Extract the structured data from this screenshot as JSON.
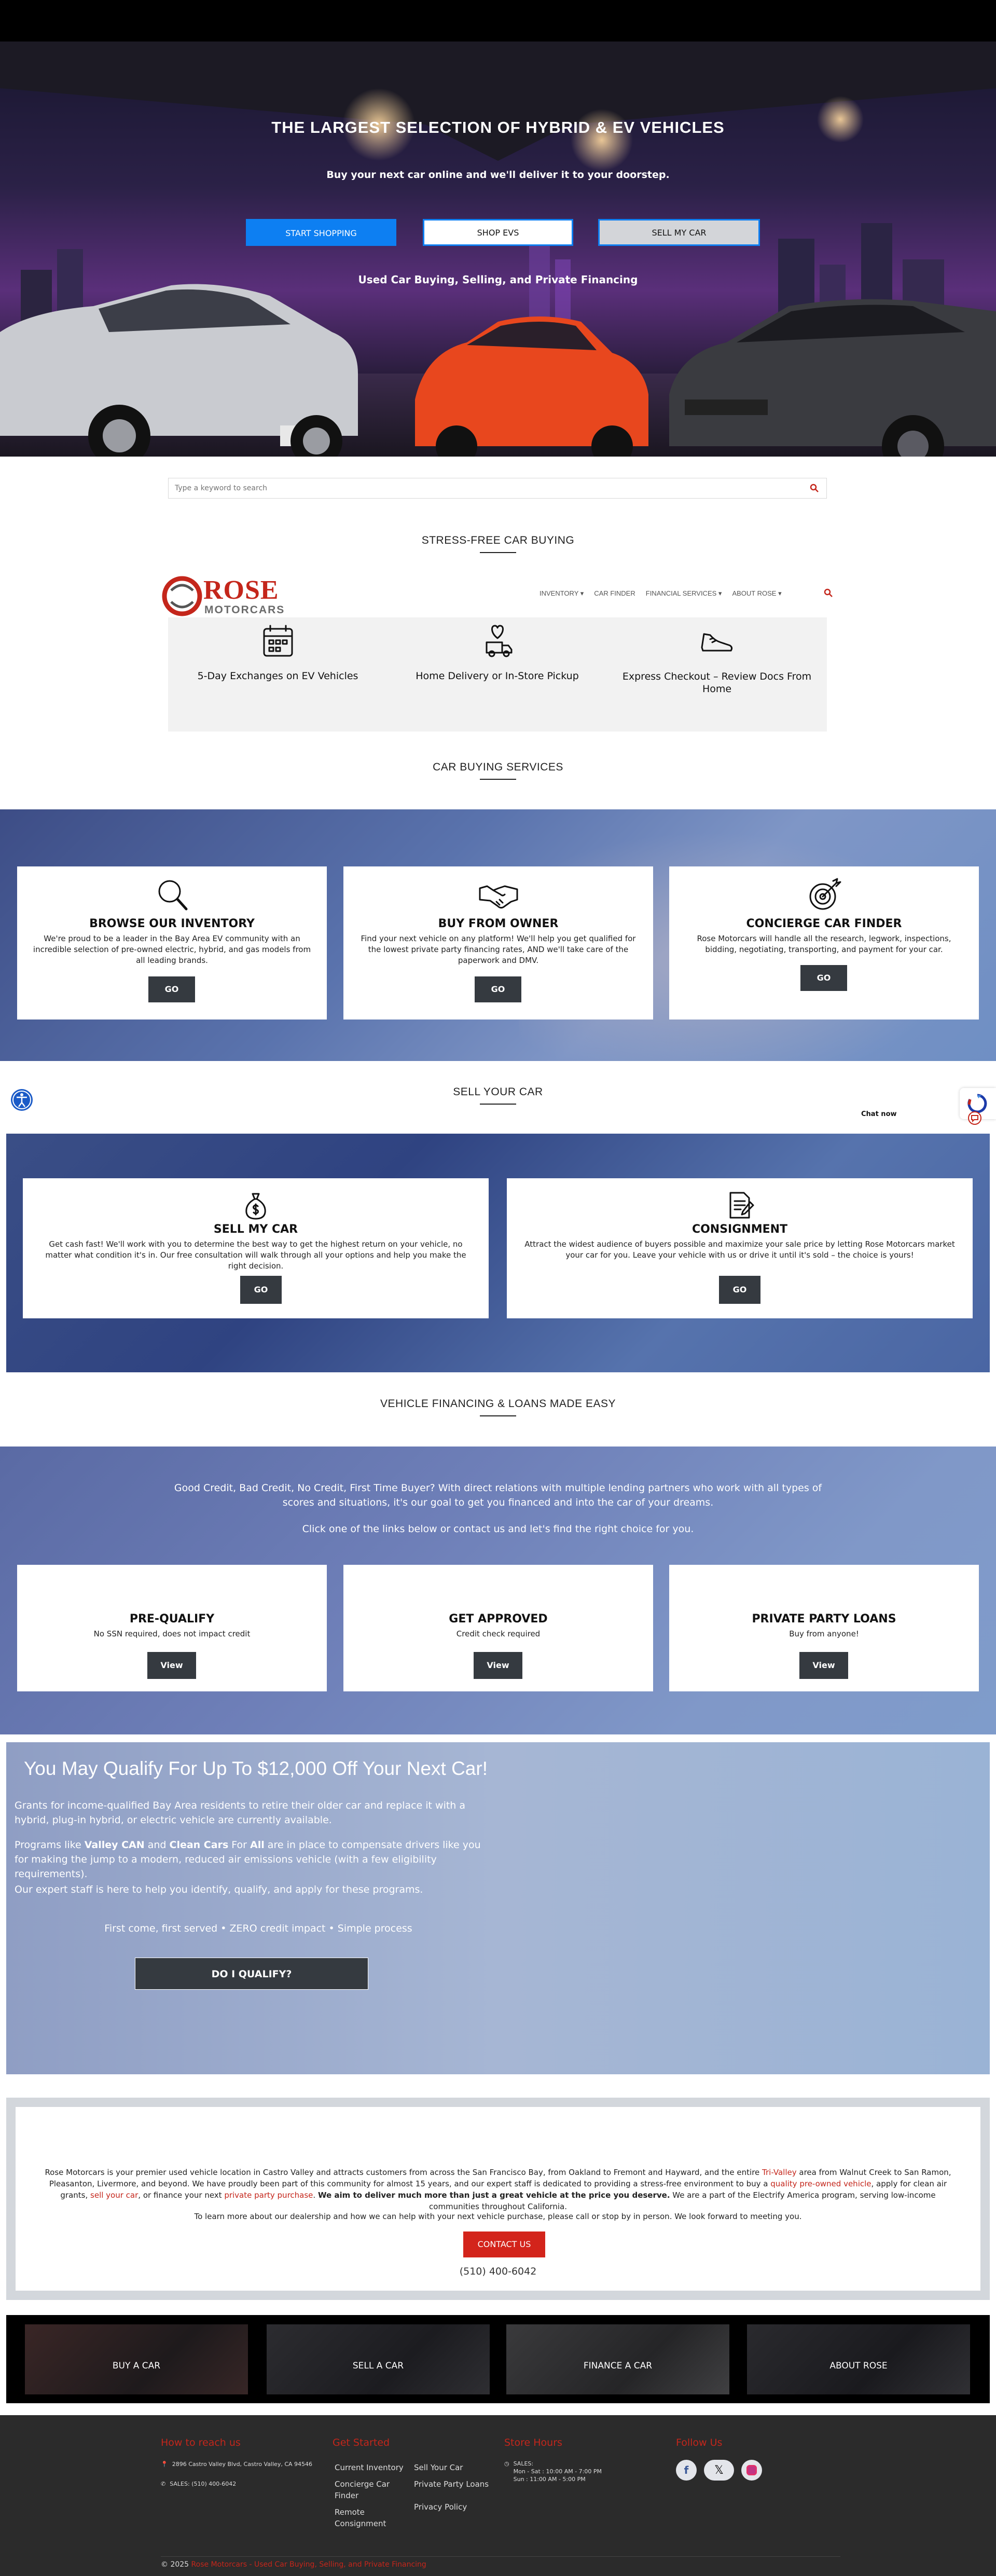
{
  "hero": {
    "title": "THE LARGEST SELECTION OF HYBRID & EV VEHICLES",
    "subtitle": "Buy your next car online and we'll deliver it to your doorstep.",
    "btn_shop": "START SHOPPING",
    "btn_evs": "SHOP EVS",
    "btn_sell": "SELL MY CAR",
    "tagline": "Used Car Buying, Selling, and Private Financing"
  },
  "search": {
    "placeholder": "Type a keyword to search"
  },
  "stress": {
    "title": "STRESS-FREE CAR BUYING"
  },
  "nav": {
    "logo_top": "ROSE",
    "logo_bottom": "MOTORCARS",
    "items": [
      {
        "label": "INVENTORY"
      },
      {
        "label": "CAR FINDER"
      },
      {
        "label": "FINANCIAL SERVICES"
      },
      {
        "label": "ABOUT ROSE"
      }
    ]
  },
  "features": [
    {
      "label": "5-Day Exchanges on EV Vehicles"
    },
    {
      "label": "Home Delivery or In-Store Pickup"
    },
    {
      "label": "Express Checkout – Review Docs From Home"
    }
  ],
  "services": {
    "title": "CAR BUYING SERVICES",
    "cards": [
      {
        "title": "BROWSE OUR INVENTORY",
        "text": "We're proud to be a leader in the Bay Area EV community with an incredible selection of pre-owned electric, hybrid, and gas models from all leading brands.",
        "btn": "GO"
      },
      {
        "title": "BUY FROM OWNER",
        "text": "Find your next vehicle on any platform! We'll help you get qualified for the lowest private party financing rates, AND we'll take care of the paperwork and DMV.",
        "btn": "GO"
      },
      {
        "title": "CONCIERGE CAR FINDER",
        "text": "Rose Motorcars will handle all the research, legwork, inspections, bidding, negotiating, transporting, and payment for your car.",
        "btn": "GO"
      }
    ]
  },
  "sell": {
    "title": "SELL YOUR CAR",
    "chat": "Chat now",
    "cards": [
      {
        "title": "SELL MY CAR",
        "text": "Get cash fast! We'll work with you to determine the best way to get the highest return on your vehicle, no matter what condition it's in. Our free consultation will walk through all your options and help you make the right decision.",
        "btn": "GO"
      },
      {
        "title": "CONSIGNMENT",
        "text": "Attract the widest audience of buyers possible and maximize your sale price by letting Rose Motorcars market your car for you. Leave your vehicle with us or drive it until it's sold – the choice is yours!",
        "btn": "GO"
      }
    ]
  },
  "financing": {
    "title": "VEHICLE FINANCING & LOANS MADE EASY",
    "intro": "Good Credit, Bad Credit, No Credit, First Time Buyer? With direct relations with multiple lending partners who work with all types of scores and situations, it's our goal to get you financed and into the car of your dreams.",
    "cta": "Click one of the links below or contact us and let's find the right choice for you.",
    "cards": [
      {
        "title": "PRE-QUALIFY",
        "text": "No SSN required, does not impact credit",
        "btn": "View"
      },
      {
        "title": "GET APPROVED",
        "text": "Credit check required",
        "btn": "View"
      },
      {
        "title": "PRIVATE PARTY LOANS",
        "text": "Buy from anyone!",
        "btn": "View"
      }
    ]
  },
  "qualify": {
    "title": "You May Qualify For Up To $12,000 Off Your Next Car!",
    "p1": "Grants for income-qualified Bay Area residents to retire their older car and replace it with a hybrid, plug-in hybrid, or electric vehicle are currently available.",
    "p2a": "Programs like ",
    "p2b": "Valley CAN",
    "p2c": " and ",
    "p2d": "Clean Cars",
    "p2e": " For ",
    "p2f": "All",
    "p2g": " are in place to compensate drivers like you for making the jump to a modern, reduced air emissions vehicle (with a few eligibility requirements).",
    "p3": "Our expert staff is here to help you identify, qualify, and apply for these programs.",
    "small": "First come, first served • ZERO credit impact • Simple process",
    "btn": "DO I QUALIFY?"
  },
  "about": {
    "t1": "Rose Motorcars is your premier used vehicle location in Castro Valley and attracts customers from across the San Francisco Bay, from Oakland to Fremont and Hayward, and the entire ",
    "l1": "Tri-Valley",
    "t2": " area from Walnut Creek to San Ramon, Pleasanton, Livermore, and beyond. We have proudly been part of this community for almost 15 years, and our expert staff is dedicated to providing a stress-free environment to buy a ",
    "l2": "quality pre-owned vehicle",
    "t3": ", apply for clean air grants, ",
    "l3": "sell your car",
    "t4": ", or finance your next ",
    "l4": "private party purchase",
    "t5": ". ",
    "b1": "We aim to deliver much more than just a great vehicle at the price you deserve.",
    "t6": " We are a part of the Electrify America program, serving low-income communities throughout California.",
    "p2": "To learn more about our dealership and how we can help with your next vehicle purchase, please call or stop by in person. We look forward to meeting you.",
    "btn": "CONTACT US",
    "phone": "(510) 400-6042"
  },
  "tiles": [
    {
      "label": "BUY A CAR"
    },
    {
      "label": "SELL A CAR"
    },
    {
      "label": "FINANCE A CAR"
    },
    {
      "label": "ABOUT ROSE"
    }
  ],
  "footer": {
    "reach_title": "How to reach us",
    "address": "2896 Castro Valley Blvd, Castro Valley, CA 94546",
    "sales": "SALES: (510) 400-6042",
    "started_title": "Get Started",
    "links_a": [
      {
        "label": "Current Inventory"
      },
      {
        "label": "Concierge Car Finder"
      },
      {
        "label": "Remote Consignment"
      }
    ],
    "links_b": [
      {
        "label": "Sell Your Car"
      },
      {
        "label": "Private Party Loans"
      },
      {
        "label": "Privacy Policy"
      }
    ],
    "hours_title": "Store Hours",
    "hours_label": "SALES:",
    "hours_1": "Mon - Sat : 10:00 AM - 7:00 PM",
    "hours_2": "Sun : 11:00 AM - 5:00 PM",
    "follow_title": "Follow Us",
    "copyright": "© 2025 ",
    "copy_link": "Rose Motorcars - Used Car Buying, Selling, and Private Financing"
  },
  "colors": {
    "brand_red": "#c4261b",
    "dark": "#353a40",
    "blue_btn": "#0d7ff2",
    "footer": "#2b2b2b"
  }
}
